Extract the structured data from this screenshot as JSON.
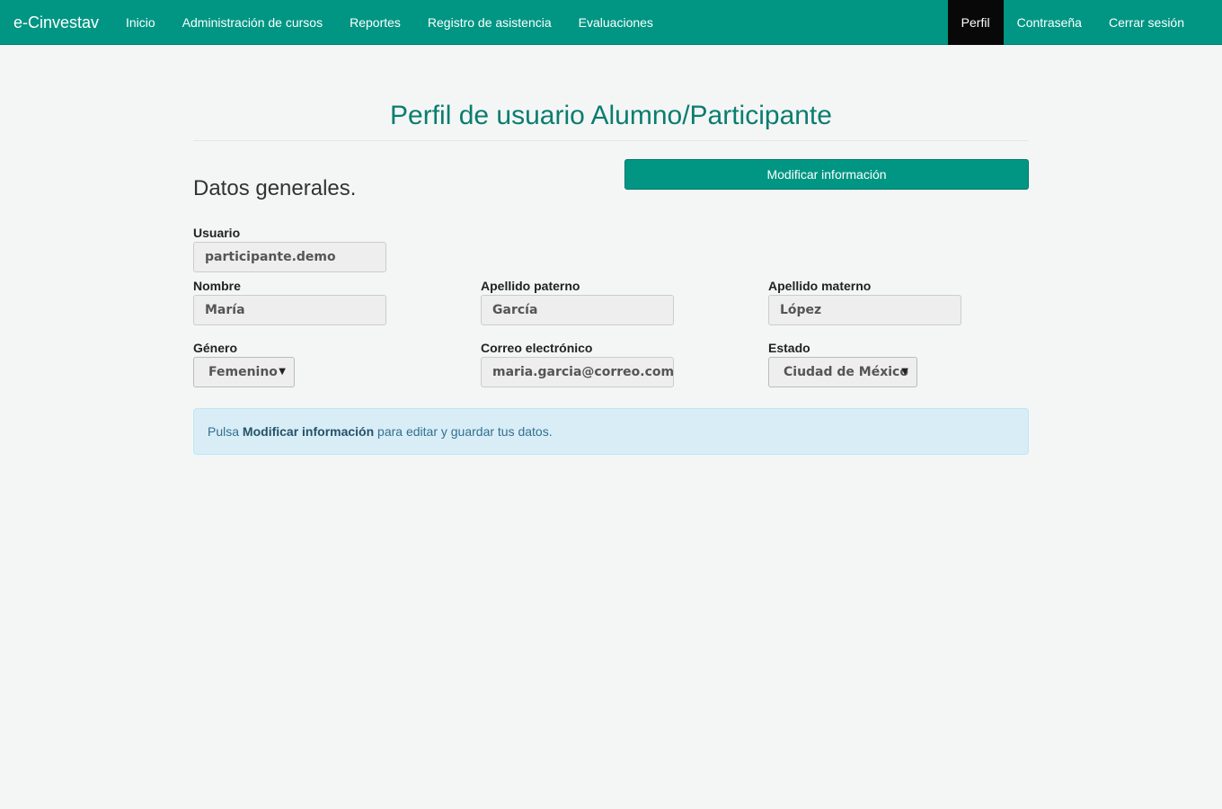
{
  "navbar": {
    "brand": "e-Cinvestav",
    "left_items": [
      {
        "label": "Inicio"
      },
      {
        "label": "Administración de cursos"
      },
      {
        "label": "Reportes"
      },
      {
        "label": "Registro de asistencia"
      },
      {
        "label": "Evaluaciones"
      }
    ],
    "right_items": [
      {
        "label": "Perfil",
        "active": true
      },
      {
        "label": "Contraseña"
      },
      {
        "label": "Cerrar sesión"
      }
    ]
  },
  "page": {
    "title": "Perfil de usuario Alumno/Participante",
    "section_heading": "Datos generales.",
    "modify_button": "Modificar información"
  },
  "form": {
    "usuario": {
      "label": "Usuario",
      "value": "participante.demo"
    },
    "nombre": {
      "label": "Nombre",
      "value": "María"
    },
    "apellido_paterno": {
      "label": "Apellido paterno",
      "value": "García"
    },
    "apellido_materno": {
      "label": "Apellido materno",
      "value": "López"
    },
    "genero": {
      "label": "Género",
      "value": "Femenino"
    },
    "correo": {
      "label": "Correo electrónico",
      "value": "maria.garcia@correo.com"
    },
    "estado": {
      "label": "Estado",
      "value": "Ciudad de México"
    }
  },
  "alert": {
    "prefix": "Pulsa ",
    "emphasis": "Modificar información",
    "suffix": " para editar y guardar tus datos."
  },
  "colors": {
    "navbar": "#009683",
    "active_nav": "#080808",
    "title": "#0a7d6e",
    "alert_bg": "#d9edf7"
  }
}
